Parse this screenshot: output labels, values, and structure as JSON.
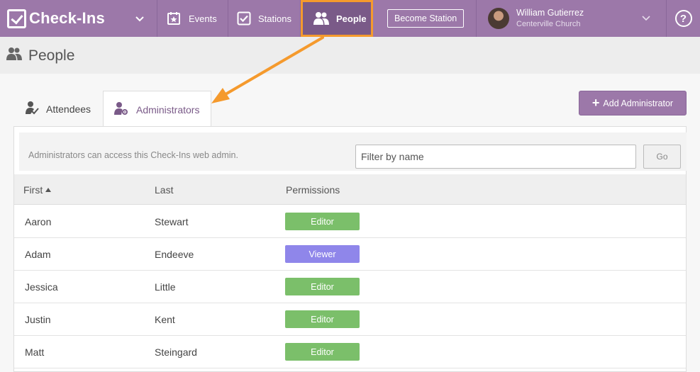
{
  "app": {
    "brand": "Check-Ins"
  },
  "nav": {
    "events_label": "Events",
    "stations_label": "Stations",
    "people_label": "People",
    "become_station_label": "Become Station"
  },
  "user": {
    "name": "William Gutierrez",
    "org": "Centerville Church"
  },
  "help_glyph": "?",
  "page": {
    "title": "People"
  },
  "tabs": [
    {
      "label": "Attendees",
      "active": false
    },
    {
      "label": "Administrators",
      "active": true
    }
  ],
  "add_admin_label": "Add Administrator",
  "info_text": "Administrators can access this Check-Ins web admin.",
  "filter": {
    "placeholder": "Filter by name",
    "value": ""
  },
  "go_label": "Go",
  "table": {
    "headers": {
      "first": "First",
      "last": "Last",
      "permissions": "Permissions"
    },
    "sorted_by": "First",
    "rows": [
      {
        "first": "Aaron",
        "last": "Stewart",
        "permission": "Editor"
      },
      {
        "first": "Adam",
        "last": "Endeeve",
        "permission": "Viewer"
      },
      {
        "first": "Jessica",
        "last": "Little",
        "permission": "Editor"
      },
      {
        "first": "Justin",
        "last": "Kent",
        "permission": "Editor"
      },
      {
        "first": "Matt",
        "last": "Steingard",
        "permission": "Editor"
      }
    ]
  },
  "colors": {
    "brand": "#9c78a9",
    "active_nav": "#7a5a88",
    "highlight": "#f59a2d",
    "editor": "#7bbf6a",
    "viewer": "#8f86ea"
  }
}
